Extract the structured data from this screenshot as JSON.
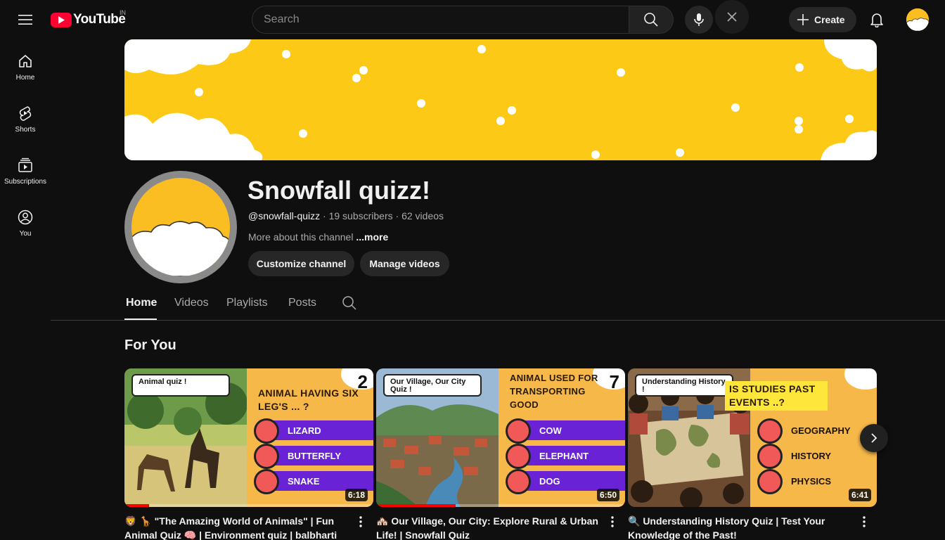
{
  "header": {
    "logo_text": "YouTube",
    "country_code": "IN",
    "search_placeholder": "Search",
    "create_label": "Create"
  },
  "sidebar": {
    "items": [
      {
        "label": "Home",
        "icon": "home-icon"
      },
      {
        "label": "Shorts",
        "icon": "shorts-icon"
      },
      {
        "label": "Subscriptions",
        "icon": "subscriptions-icon"
      },
      {
        "label": "You",
        "icon": "you-icon"
      }
    ]
  },
  "channel": {
    "name": "Snowfall quizz!",
    "handle": "@snowfall-quizz",
    "subscribers": "19 subscribers",
    "videos": "62 videos",
    "about": "More about this channel",
    "more": "...more",
    "customize_label": "Customize channel",
    "manage_label": "Manage videos"
  },
  "tabs": [
    {
      "label": "Home",
      "active": true
    },
    {
      "label": "Videos",
      "active": false
    },
    {
      "label": "Playlists",
      "active": false
    },
    {
      "label": "Posts",
      "active": false
    }
  ],
  "section": {
    "title": "For You"
  },
  "videos": [
    {
      "tag": "Animal quiz !",
      "question": "ANIMAL HAVING SIX LEG'S ... ?",
      "number": "2",
      "options": [
        "LIZARD",
        "BUTTERFLY",
        "SNAKE"
      ],
      "duration": "6:18",
      "watched_fraction": 0.1,
      "title": "🦁 🦒 \"The Amazing World of Animals\" | Fun Animal Quiz 🧠 | Environment quiz | balbharti evs quiz"
    },
    {
      "tag": "Our Village, Our City Quiz !",
      "question": "ANIMAL USED FOR TRANSPORTING GOOD",
      "number": "7",
      "options": [
        "COW",
        "ELEPHANT",
        "DOG"
      ],
      "duration": "6:50",
      "watched_fraction": 0.32,
      "title": "🏘️ Our Village, Our City: Explore Rural & Urban Life! | Snowfall Quiz"
    },
    {
      "tag": "Understanding History !",
      "question": "IS STUDIES PAST EVENTS ..?",
      "number": "",
      "options": [
        "GEOGRAPHY",
        "HISTORY",
        "PHYSICS"
      ],
      "duration": "6:41",
      "watched_fraction": 0,
      "title": "🔍 Understanding History Quiz | Test Your Knowledge of the Past!"
    }
  ],
  "colors": {
    "background": "#0f0f0f",
    "banner": "#fcc916",
    "brand_red": "#ff0033",
    "thumb_panel": "#f7b84a",
    "option_purple": "#6a22d6"
  }
}
